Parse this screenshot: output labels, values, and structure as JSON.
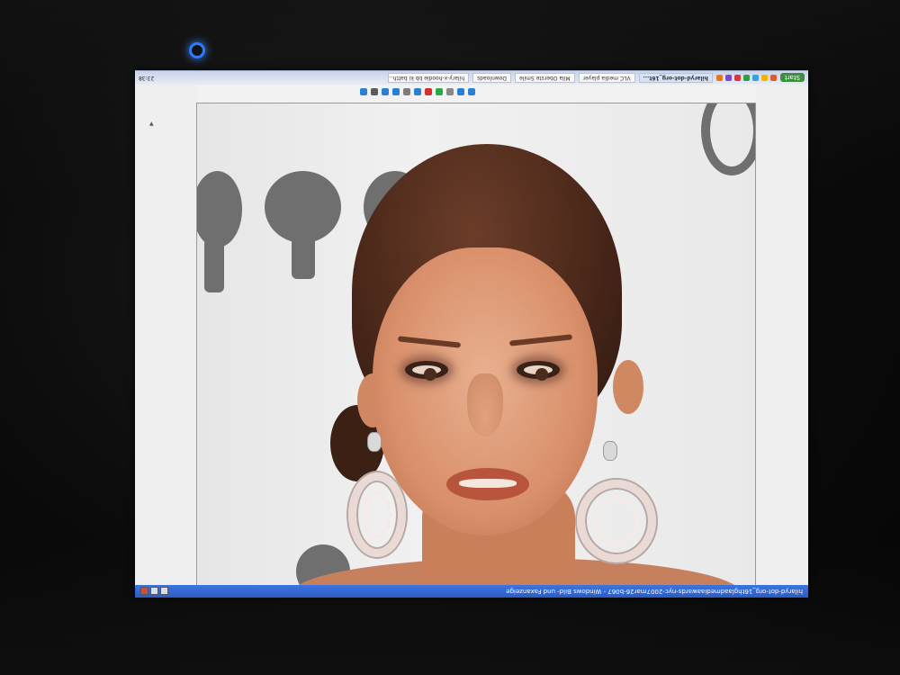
{
  "window": {
    "title": "hilaryd-dot-org_16thglaadmediaawards-nyc-2007mar26-b067 - Windows Bild- und Faxanzeige"
  },
  "taskbar": {
    "start_label": "Start",
    "tasks": [
      {
        "label": "hilaryd-dot-org_16t...",
        "active": true
      },
      {
        "label": "VLC media player",
        "active": false
      },
      {
        "label": "Mila Oberste Smile",
        "active": false
      },
      {
        "label": "Downloads",
        "active": false
      },
      {
        "label": "hilary-x-hoodie bb ki batth...",
        "active": false
      }
    ],
    "clock": "23:38"
  },
  "icons": {
    "led": "power-led-icon",
    "tray_colors": [
      "#e05a2a",
      "#f0b400",
      "#39a0e0",
      "#2f9e44",
      "#d43a3a",
      "#7a48c8",
      "#e07a1a"
    ],
    "tool_colors": [
      "#2a7fd4",
      "#2a7fd4",
      "#888888",
      "#2aa84a",
      "#d43030",
      "#2a7fd4",
      "#7d7d7d",
      "#2a7fd4",
      "#2a7fd4",
      "#5a5a5a",
      "#2a7fd4"
    ]
  }
}
